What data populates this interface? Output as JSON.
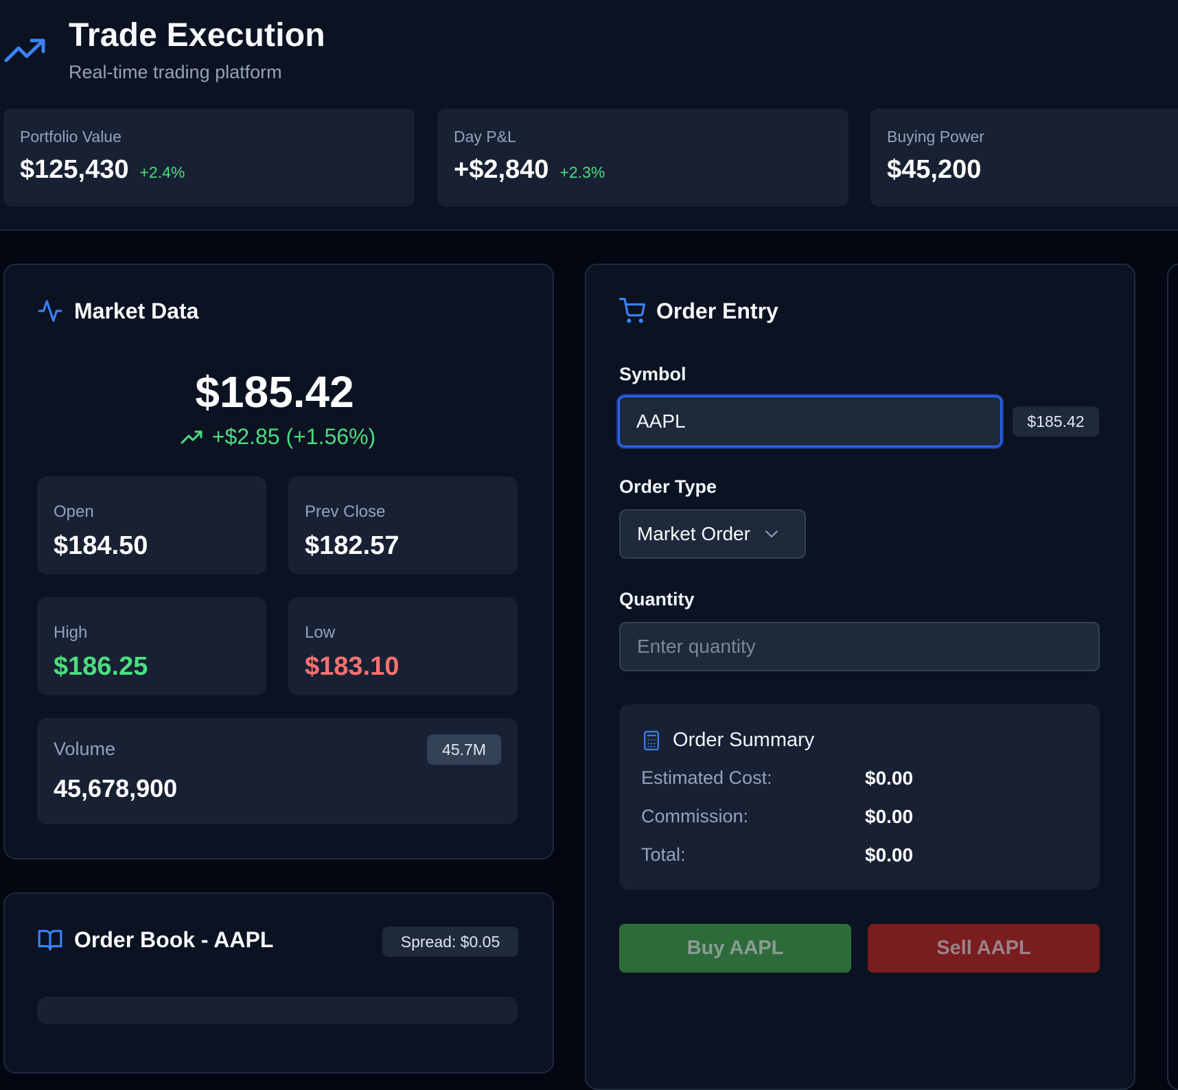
{
  "header": {
    "title": "Trade Execution",
    "subtitle": "Real-time trading platform"
  },
  "stats": [
    {
      "label": "Portfolio Value",
      "value": "$125,430",
      "change": "+2.4%"
    },
    {
      "label": "Day P&L",
      "value": "+$2,840",
      "change": "+2.3%"
    },
    {
      "label": "Buying Power",
      "value": "$45,200",
      "change": ""
    }
  ],
  "market_data": {
    "title": "Market Data",
    "price": "$185.42",
    "change": "+$2.85 (+1.56%)",
    "open_label": "Open",
    "open": "$184.50",
    "prev_close_label": "Prev Close",
    "prev_close": "$182.57",
    "high_label": "High",
    "high": "$186.25",
    "low_label": "Low",
    "low": "$183.10",
    "volume_label": "Volume",
    "volume": "45,678,900",
    "volume_badge": "45.7M"
  },
  "order_book": {
    "title": "Order Book - AAPL",
    "spread": "Spread: $0.05"
  },
  "order_entry": {
    "title": "Order Entry",
    "symbol_label": "Symbol",
    "symbol_value": "AAPL",
    "symbol_price": "$185.42",
    "order_type_label": "Order Type",
    "order_type_value": "Market Order",
    "quantity_label": "Quantity",
    "quantity_placeholder": "Enter quantity",
    "summary": {
      "title": "Order Summary",
      "estimated_cost_label": "Estimated Cost:",
      "estimated_cost": "$0.00",
      "commission_label": "Commission:",
      "commission": "$0.00",
      "total_label": "Total:",
      "total": "$0.00"
    },
    "buy_label": "Buy AAPL",
    "sell_label": "Sell AAPL"
  },
  "colors": {
    "accent": "#3b82f6",
    "positive": "#4ade80",
    "negative": "#f87171",
    "background": "#030712"
  },
  "icons": {
    "app": "trending-up-icon",
    "market_data": "activity-icon",
    "order_entry": "shopping-cart-icon",
    "order_summary": "calculator-icon",
    "order_book": "book-open-icon",
    "price_change": "trending-up-icon",
    "order_type": "chevron-down-icon"
  }
}
